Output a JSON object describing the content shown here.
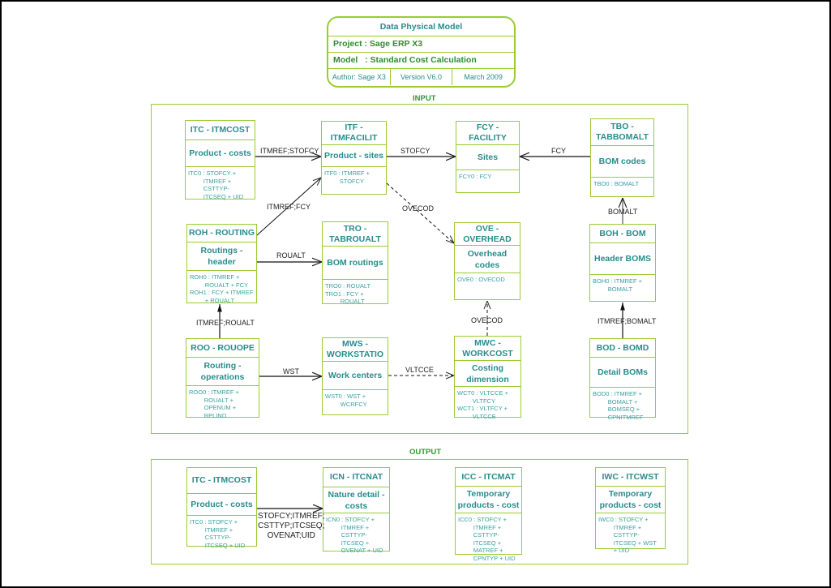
{
  "title_card": {
    "title": "Data Physical Model",
    "project": "Project : Sage ERP X3",
    "model": "Model   : Standard Cost Calculation",
    "author": "Author: Sage X3",
    "version": "Version V6.0",
    "date": "March 2009"
  },
  "sections": {
    "input": "INPUT",
    "output": "OUTPUT"
  },
  "entities": {
    "itc_in": {
      "header": "ITC - ITMCOST",
      "desc": "Product - costs",
      "keys": "ITC0 : STOFCY +\n         ITMREF +\n         CSTTYP-\n         ITCSEQ + UID"
    },
    "itf": {
      "header": "ITF -\nITMFACILIT",
      "desc": "Product - sites",
      "keys": "ITF0 : ITMREF +\n         STOFCY"
    },
    "fcy": {
      "header": "FCY -\nFACILITY",
      "desc": "Sites",
      "keys": "FCY0 : FCY"
    },
    "tbo": {
      "header": "TBO -\nTABBOMALT",
      "desc": "BOM codes",
      "keys": "TBO0 : BOMALT"
    },
    "roh": {
      "header": "ROH - ROUTING",
      "desc": "Routings -\nheader",
      "keys": "ROH0 : ITMREF +\n         ROUALT + FCY\nROH1 : FCY + ITMREF\n         + ROUALT"
    },
    "tro": {
      "header": "TRO -\nTABROUALT",
      "desc": "BOM routings",
      "keys": "TRO0 : ROUALT\nTRO1 : FCY +\n         ROUALT"
    },
    "ove": {
      "header": "OVE -\nOVERHEAD",
      "desc": "Overhead\ncodes",
      "keys": "OVE0 : OVECOD"
    },
    "boh": {
      "header": "BOH - BOM",
      "desc": "Header BOMS",
      "keys": "BOH0 : ITMREF +\n         BOMALT"
    },
    "roo": {
      "header": "ROO - ROUOPE",
      "desc": "Routing -\noperations",
      "keys": "ROO0 : ITMREF +\n         ROUALT +\n         OPENUM +\n         RPLIND"
    },
    "mws": {
      "header": "MWS -\nWORKSTATIO",
      "desc": "Work centers",
      "keys": "WST0 : WST +\n         WCRFCY"
    },
    "mwc": {
      "header": "MWC -\nWORKCOST",
      "desc": "Costing\ndimension",
      "keys": "WCT0 : VLTCCE +\n         VLTFCY\nWCT1 : VLTFCY +\n         VLTCCE"
    },
    "bod": {
      "header": "BOD - BOMD",
      "desc": "Detail BOMs",
      "keys": "BOD0 : ITMREF +\n         BOMALT +\n         BOMSEQ +\n         CPNITMREF"
    },
    "itc_out": {
      "header": "ITC - ITMCOST",
      "desc": "Product - costs",
      "keys": "ITC0 : STOFCY +\n         ITMREF +\n         CSTTYP-\n         ITCSEQ + UID"
    },
    "icn": {
      "header": "ICN - ITCNAT",
      "desc": "Nature detail -\ncosts",
      "keys": "ICN0 : STOFCY +\n         ITMREF +\n         CSTTYP-\n         ITCSEQ +\n         OVENAT + UID"
    },
    "icc": {
      "header": "ICC - ITCMAT",
      "desc": "Temporary\nproducts - cost",
      "keys": "ICC0 : STOFCY +\n         ITMREF +\n         CSTTYP-\n         ITCSEQ +\n         MATREF +\n         CPNTYP + UID"
    },
    "iwc": {
      "header": "IWC - ITCWST",
      "desc": "Temporary\nproducts - cost",
      "keys": "IWC0 : STOFCY +\n         ITMREF +\n         CSTTYP-\n         ITCSEQ + WST\n         + UID"
    }
  },
  "links": {
    "itc_itf": "ITMREF;STOFCY",
    "roh_itf": "ITMREF;FCY",
    "itf_fcy": "STOFCY",
    "tbo_fcy": "FCY",
    "itf_ove": "OVECOD",
    "boh_tbo": "BOMALT",
    "roh_tro": "ROUALT",
    "roo_roh": "ITMREF;ROUALT",
    "mwc_ove": "OVECOD",
    "bod_boh": "ITMREF;BOMALT",
    "roo_mws": "WST",
    "mws_mwc": "VLTCCE",
    "itc_icn": "STOFCY;ITMREF;\nCSTTYP;ITCSEQ;\nOVENAT;UID"
  }
}
